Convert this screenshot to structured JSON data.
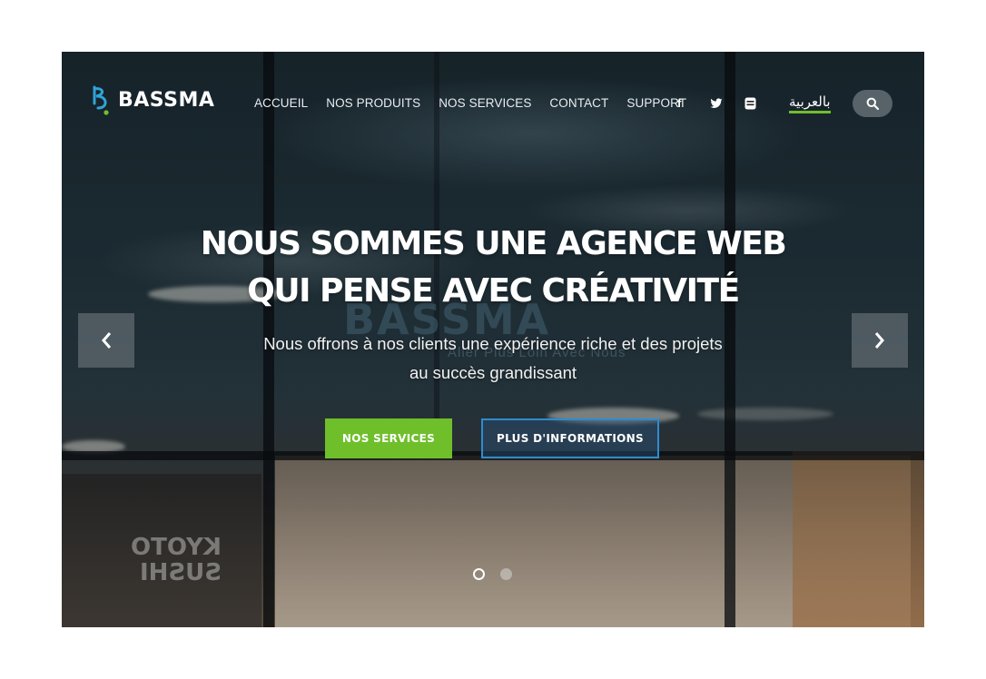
{
  "brand": {
    "name": "BASSMA"
  },
  "nav": {
    "items": [
      "ACCUEIL",
      "NOS PRODUITS",
      "NOS SERVICES",
      "CONTACT",
      "SUPPORT"
    ],
    "social": [
      "f"
    ],
    "language": "بالعربية"
  },
  "hero": {
    "title_line1": "NOUS SOMMES UNE AGENCE WEB",
    "title_line2": "QUI PENSE AVEC CRÉATIVITÉ",
    "subtitle_line1": "Nous offrons à nos clients une expérience riche et des projets",
    "subtitle_line2": "au succès grandissant",
    "primary_button": "NOS SERVICES",
    "secondary_button": "PLUS D'INFORMATIONS"
  },
  "background": {
    "watermark": "BASSMA",
    "watermark_tagline": "Aller Plus Loin Avec Nous",
    "store_sign": "KYOTO SUSHI"
  },
  "colors": {
    "accent_green": "#6fbf2b",
    "accent_blue": "#2e8ccf",
    "logo_blue": "#2fa3d8"
  },
  "carousel": {
    "slides": 2,
    "active": 1
  }
}
